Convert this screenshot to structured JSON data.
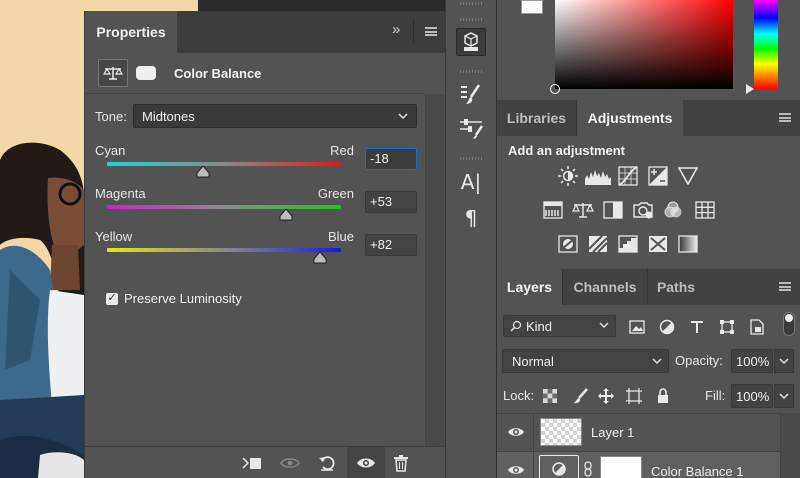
{
  "properties": {
    "tab_label": "Properties",
    "collapse_glyph": "»",
    "header_title": "Color Balance",
    "tone": {
      "label": "Tone:",
      "value": "Midtones"
    },
    "sliders": [
      {
        "left_label": "Cyan",
        "right_label": "Red",
        "value": "-18",
        "position": 0.41
      },
      {
        "left_label": "Magenta",
        "right_label": "Green",
        "value": "+53",
        "position": 0.765
      },
      {
        "left_label": "Yellow",
        "right_label": "Blue",
        "value": "+82",
        "position": 0.91
      }
    ],
    "preserve_luminosity": {
      "label": "Preserve Luminosity",
      "checked": true
    }
  },
  "adjustments_tabs": {
    "libraries": "Libraries",
    "adjustments": "Adjustments"
  },
  "adjustments": {
    "title": "Add an adjustment"
  },
  "layers_tabs": {
    "layers": "Layers",
    "channels": "Channels",
    "paths": "Paths"
  },
  "layers": {
    "kind_filter": "Kind",
    "blend_mode": "Normal",
    "opacity_label": "Opacity:",
    "opacity_value": "100%",
    "lock_label": "Lock:",
    "fill_label": "Fill:",
    "fill_value": "100%",
    "items": [
      {
        "name": "Layer 1"
      },
      {
        "name": "Color Balance 1"
      }
    ]
  },
  "tools": {
    "text_tool": "A|",
    "paragraph": "¶"
  },
  "colors": {
    "panel_bg": "#535353",
    "focus_blue": "#1a6fc7",
    "canvas_bg": "#f1d8a6"
  }
}
